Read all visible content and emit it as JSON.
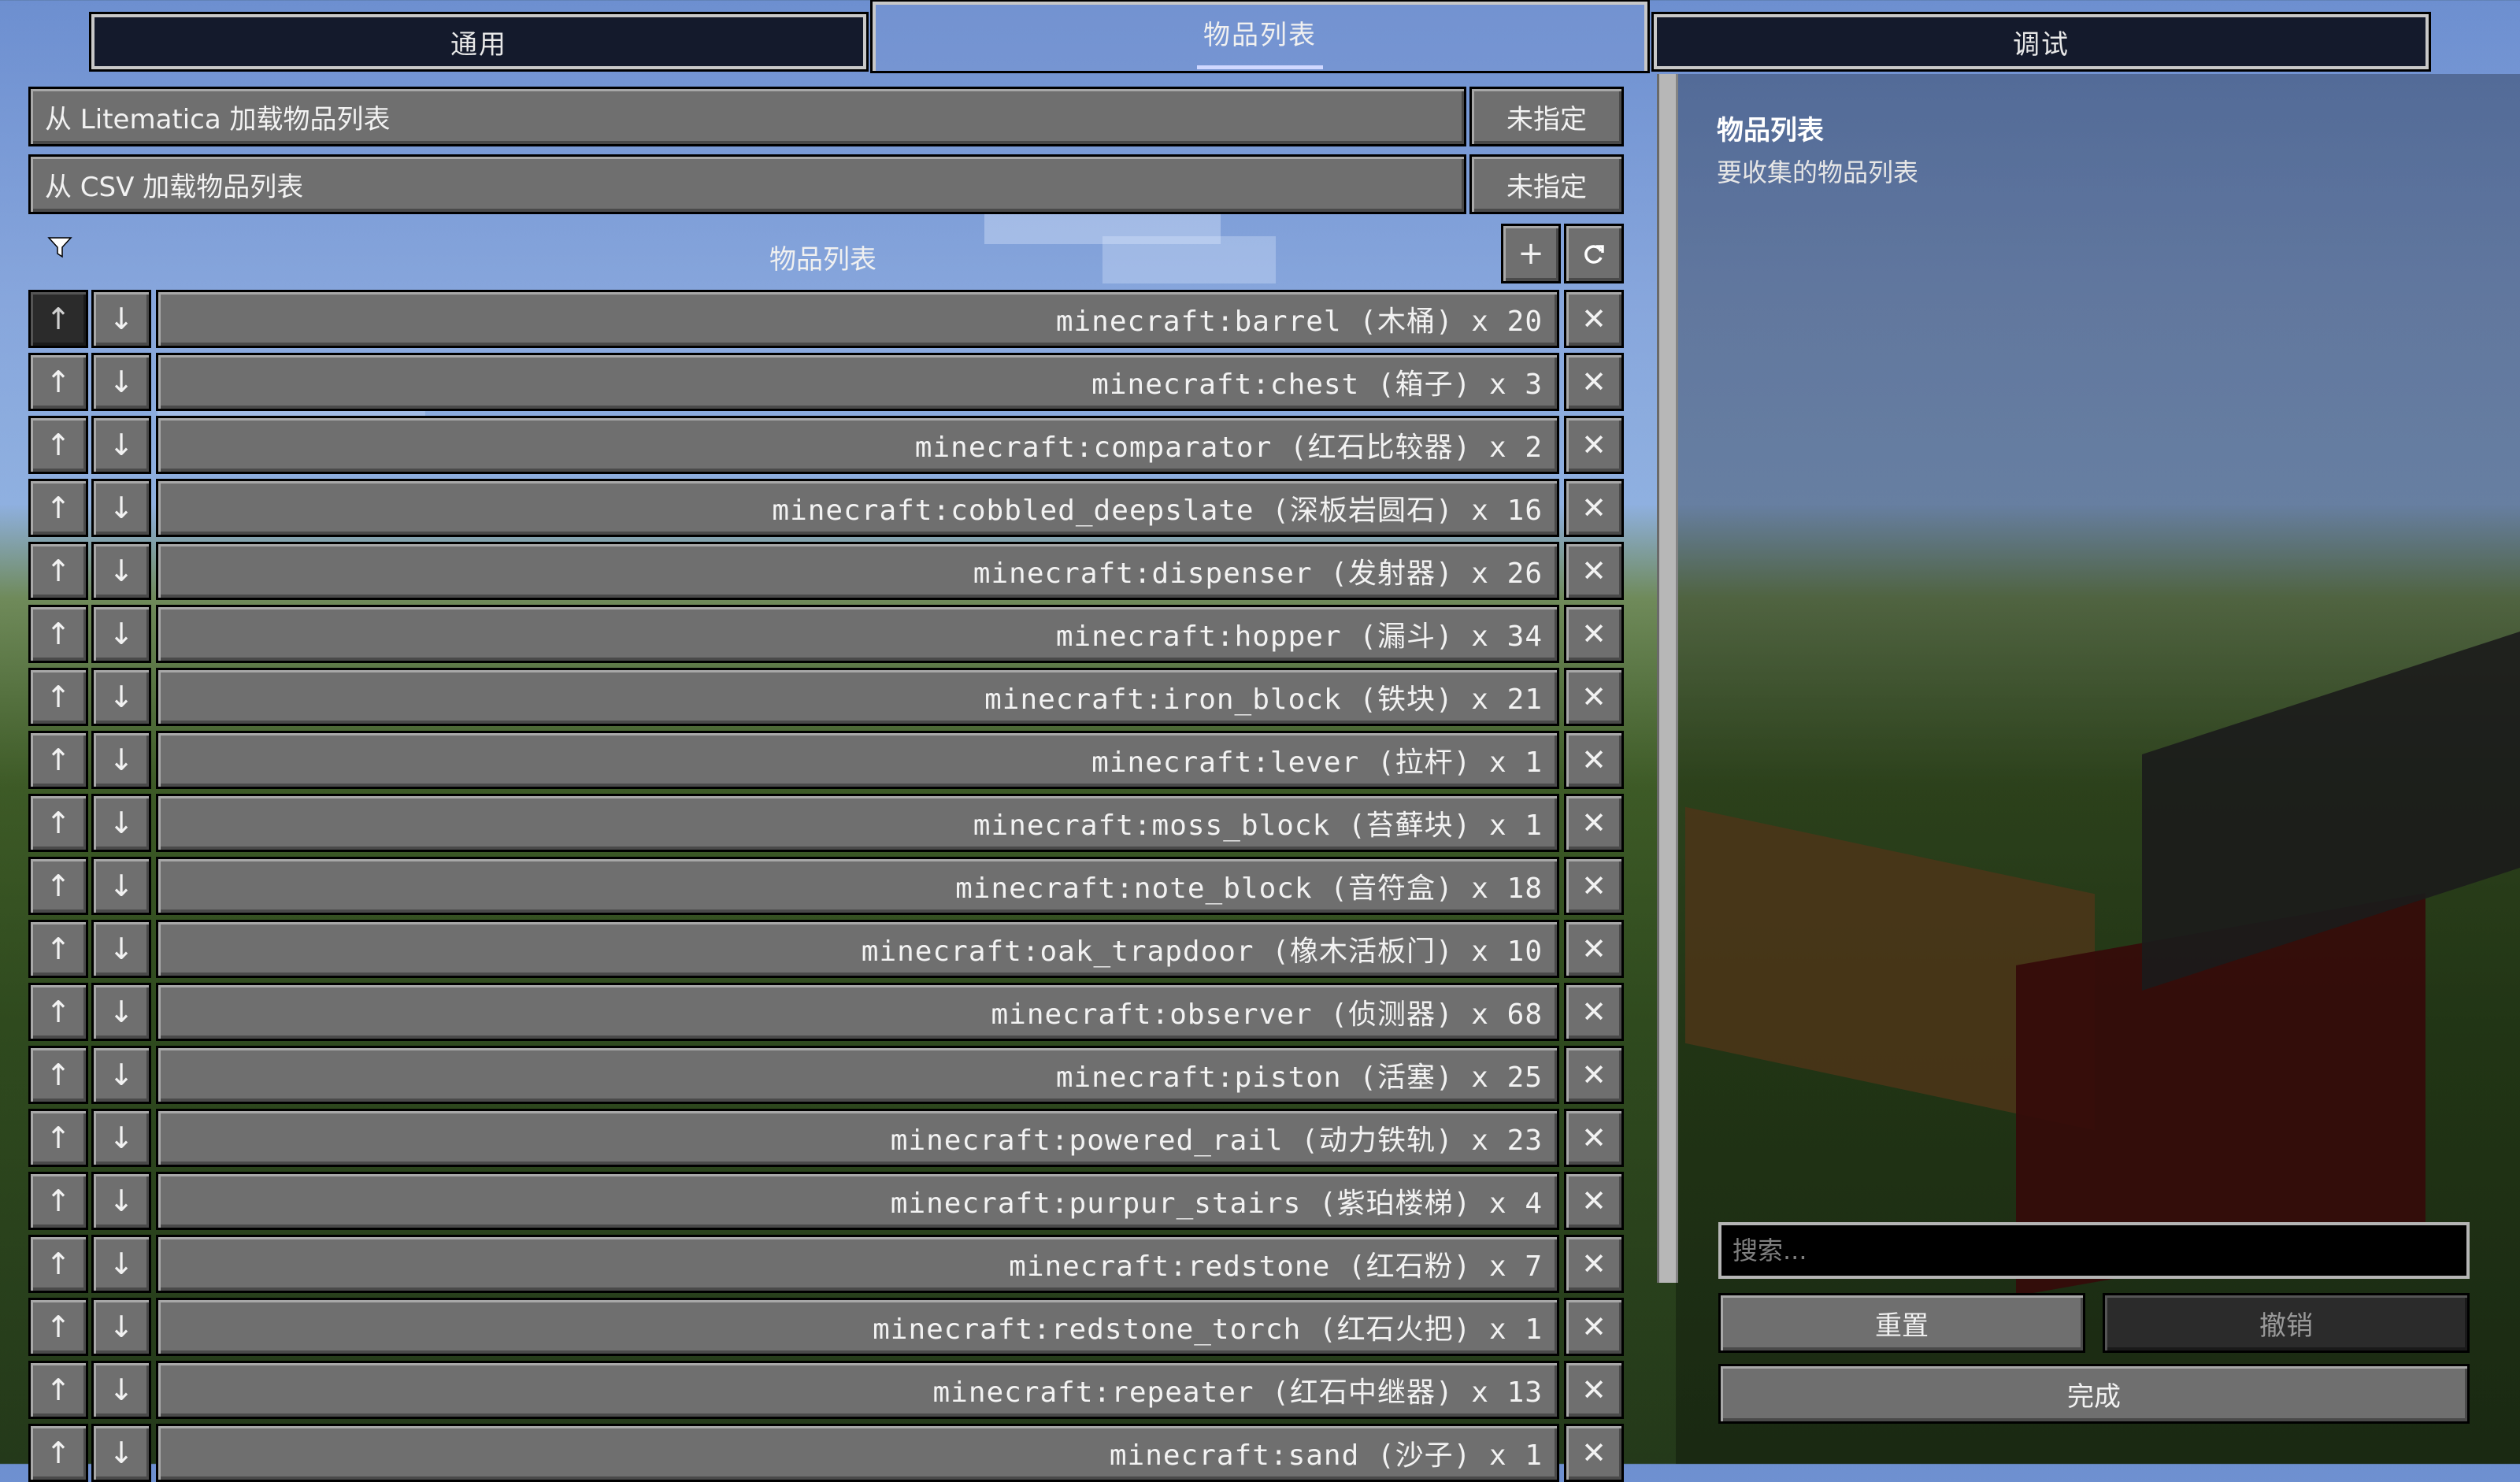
{
  "tabs": [
    {
      "label": "通用",
      "active": false
    },
    {
      "label": "物品列表",
      "active": true
    },
    {
      "label": "调试",
      "active": false
    }
  ],
  "load_rows": [
    {
      "label": "从 Litematica 加载物品列表",
      "value": "未指定"
    },
    {
      "label": "从 CSV 加载物品列表",
      "value": "未指定"
    }
  ],
  "list_header": {
    "title": "物品列表",
    "filter_icon": "filter-icon",
    "add_label": "+",
    "refresh_icon": "refresh-icon"
  },
  "items": [
    "minecraft:barrel (木桶) x 20",
    "minecraft:chest (箱子) x 3",
    "minecraft:comparator (红石比较器) x 2",
    "minecraft:cobbled_deepslate (深板岩圆石) x 16",
    "minecraft:dispenser (发射器) x 26",
    "minecraft:hopper (漏斗) x 34",
    "minecraft:iron_block (铁块) x 21",
    "minecraft:lever (拉杆) x 1",
    "minecraft:moss_block (苔藓块) x 1",
    "minecraft:note_block (音符盒) x 18",
    "minecraft:oak_trapdoor (橡木活板门) x 10",
    "minecraft:observer (侦测器) x 68",
    "minecraft:piston (活塞) x 25",
    "minecraft:powered_rail (动力铁轨) x 23",
    "minecraft:purpur_stairs (紫珀楼梯) x 4",
    "minecraft:redstone (红石粉) x 7",
    "minecraft:redstone_torch (红石火把) x 1",
    "minecraft:repeater (红石中继器) x 13",
    "minecraft:sand (沙子) x 1"
  ],
  "row_icons": {
    "up": "↑",
    "down": "↓",
    "remove": "✕"
  },
  "sidebar": {
    "title": "物品列表",
    "description": "要收集的物品列表",
    "search_placeholder": "搜索...",
    "reset_label": "重置",
    "undo_label": "撤销",
    "done_label": "完成"
  },
  "colors": {
    "button": "#6f6f6f",
    "button_dark": "#2b2b2b",
    "tab_bg": "#141a2c"
  }
}
